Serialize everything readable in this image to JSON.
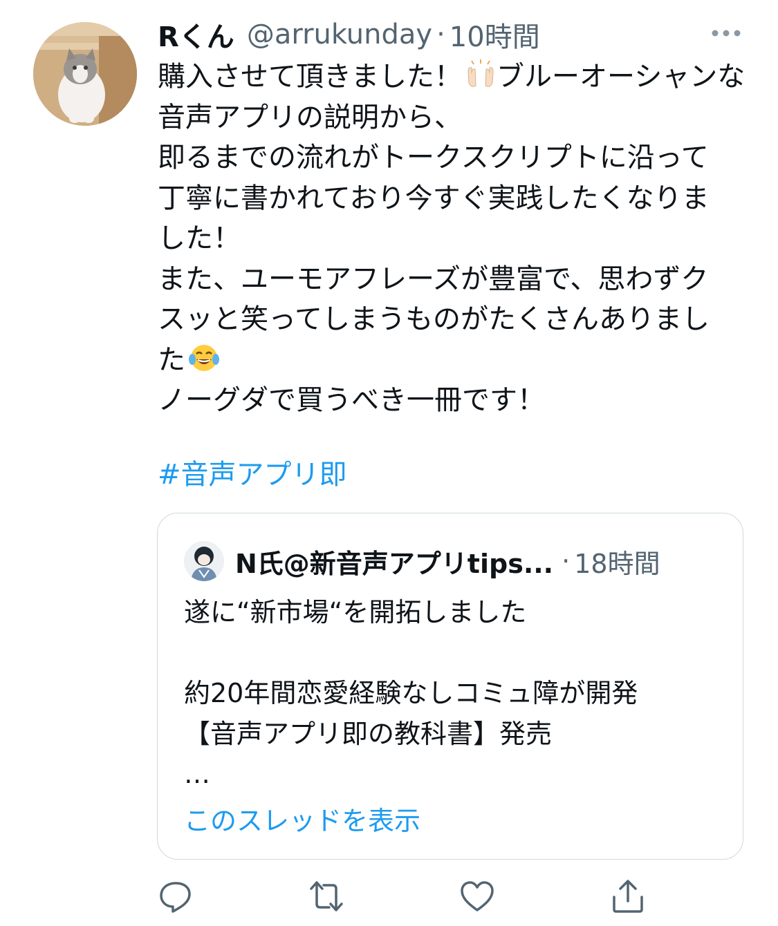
{
  "tweet": {
    "display_name": "Rくん",
    "handle": "@arrukunday",
    "separator": "·",
    "time": "10時間",
    "avatar_icon": "cat-avatar-icon",
    "more_icon": "more-horizontal-icon",
    "body_line_1": "購入させて頂きました！",
    "body_emoji_1": "raising-hands-emoji",
    "body_rest": "ブルーオーシャンな音声アプリの説明から、\n即るまでの流れがトークスクリプトに沿って\n丁寧に書かれており今すぐ実践したくなりま\nした！\nまた、ユーモアフレーズが豊富で、思わずク\nスッと笑ってしまうものがたくさんありまし\nた",
    "body_emoji_2": "face-with-tears-of-joy-emoji",
    "body_last": "\nノーグダで買うべき一冊です！",
    "hashtag": "#音声アプリ即"
  },
  "quote": {
    "display_name": "N氏@新音声アプリtips...",
    "separator": "·",
    "time": "18時間",
    "avatar_icon": "illustrated-person-avatar-icon",
    "text": "遂に“新市場“を開拓しました\n\n約20年間恋愛経験なしコミュ障が開発\n【音声アプリ即の教科書】発売\n…",
    "show_thread_link": "このスレッドを表示"
  },
  "actions": [
    {
      "icon": "reply-icon"
    },
    {
      "icon": "retweet-icon"
    },
    {
      "icon": "like-icon"
    },
    {
      "icon": "share-icon"
    }
  ],
  "colors": {
    "link": "#1d9bf0",
    "secondary_text": "#536471",
    "border": "#cfd9de",
    "primary_text": "#0f1419"
  }
}
